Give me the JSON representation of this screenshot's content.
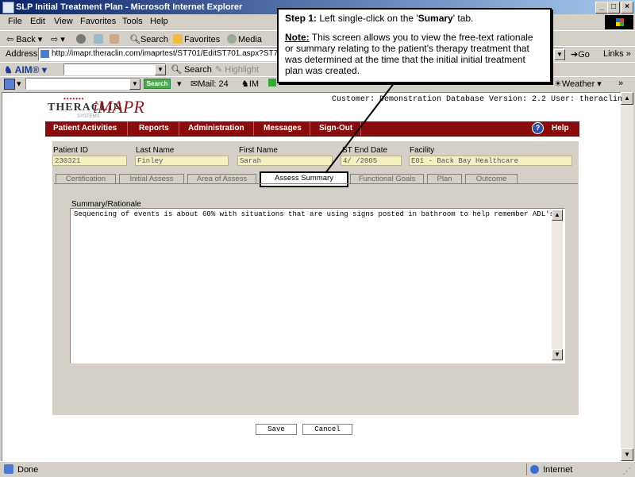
{
  "window": {
    "title": "SLP Initial Treatment Plan - Microsoft Internet Explorer"
  },
  "menu": [
    "File",
    "Edit",
    "View",
    "Favorites",
    "Tools",
    "Help"
  ],
  "toolbar": {
    "back": "Back",
    "search": "Search",
    "favorites": "Favorites",
    "media": "Media"
  },
  "address": {
    "label": "Address",
    "url": "http://imapr.theraclin.com/imaprtest/ST701/EditST701.aspx?ST701=",
    "go": "Go",
    "links": "Links"
  },
  "aim": {
    "logo": "AIM",
    "search": "Search",
    "highlight": "Highlight"
  },
  "bar4": {
    "search_button": "Search",
    "mail": "Mail: 24",
    "im": "IM",
    "weather": "Weather"
  },
  "logo": {
    "dots": "•••••••",
    "brand": "THERACLIN",
    "systems": "SYSTEMS",
    "product": "iMAPR"
  },
  "customer_info": "Customer: Demonstration Database Version: 2.2 User: theraclin",
  "nav": {
    "items": [
      "Patient Activities",
      "Reports",
      "Administration",
      "Messages",
      "Sign-Out"
    ],
    "help": "Help"
  },
  "patient": {
    "id_label": "Patient ID",
    "id": "230321",
    "last_label": "Last Name",
    "last": "Finley",
    "first_label": "First Name",
    "first": "Sarah",
    "st_end_label": "ST End Date",
    "st_end": "4/ /2005",
    "facility_label": "Facility",
    "facility": "E01 - Back Bay Healthcare"
  },
  "tabs": [
    "Certification",
    "Initial Assess",
    "Area of Assess",
    "Assess Summary",
    "Functional Goals",
    "Plan",
    "Outcome"
  ],
  "summary": {
    "label": "Summary/Rationale",
    "text": "Sequencing of events is about 60% with situations that are using signs posted in bathroom to help remember ADL's."
  },
  "buttons": {
    "save": "Save",
    "cancel": "Cancel"
  },
  "status": {
    "left": "Done",
    "zone": "Internet"
  },
  "callout": {
    "step_label": "Step 1:",
    "step_pre": " Left single-click on the '",
    "step_target": "Sumary",
    "step_post": "' tab.",
    "note_label": "Note:",
    "note_text": " This screen allows you to view the free-text rationale or summary relating to the patient's therapy treatment that was determined at the time that the initial initial treatment plan was created."
  },
  "colors": {
    "nav_bg": "#8b0c0c",
    "field_bg": "#f5f0c0",
    "brand_red": "#8b1a1a",
    "title_blue": "#0a246a"
  }
}
